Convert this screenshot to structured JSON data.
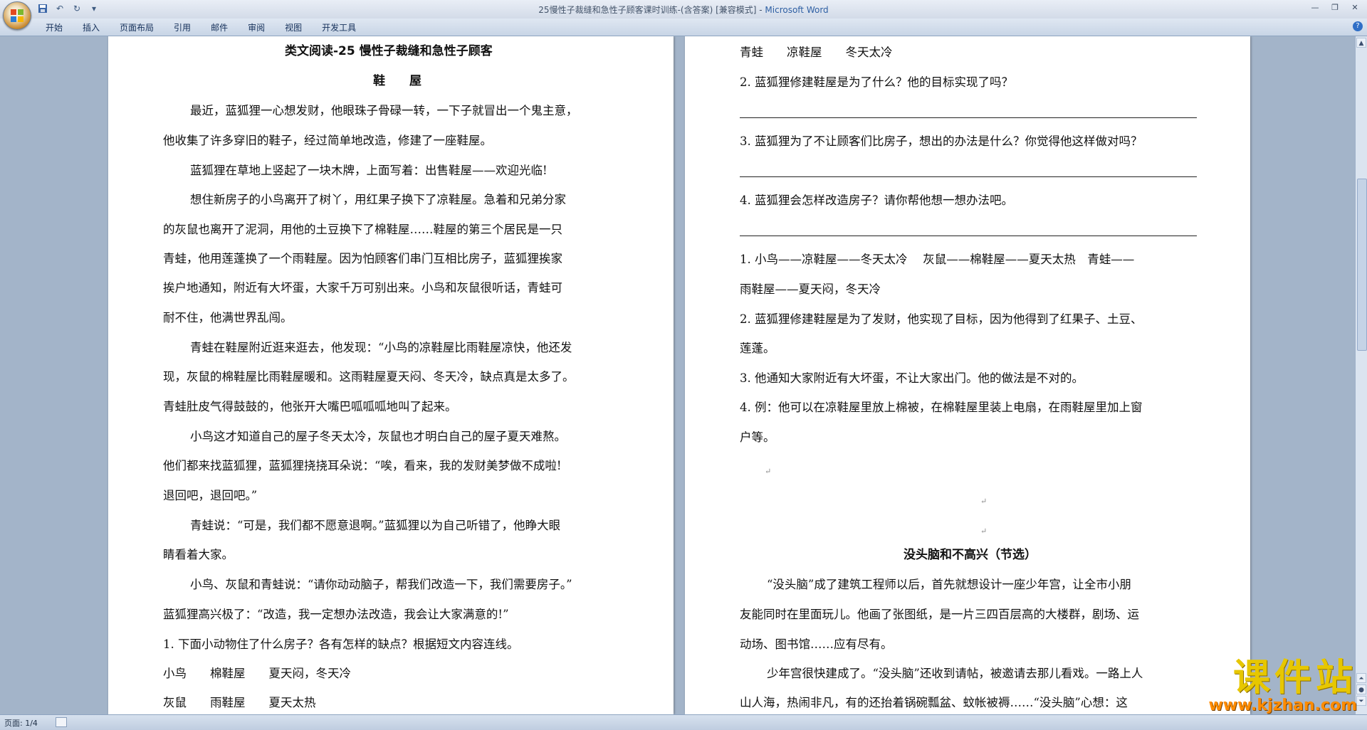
{
  "window": {
    "title_doc": "25慢性子裁缝和急性子顾客课时训练-(含答案) [兼容模式] - ",
    "title_app": "Microsoft Word"
  },
  "ribbon": {
    "tabs": [
      "开始",
      "插入",
      "页面布局",
      "引用",
      "邮件",
      "审阅",
      "视图",
      "开发工具"
    ]
  },
  "page1": {
    "title": "类文阅读-25 慢性子裁缝和急性子顾客",
    "subtitle": "鞋　　屋",
    "lines": [
      "最近，蓝狐狸一心想发财，他眼珠子骨碌一转，一下子就冒出一个鬼主意，",
      "他收集了许多穿旧的鞋子，经过简单地改造，修建了一座鞋屋。",
      "蓝狐狸在草地上竖起了一块木牌，上面写着：出售鞋屋——欢迎光临!",
      "想住新房子的小鸟离开了树丫，用红果子换下了凉鞋屋。急着和兄弟分家",
      "的灰鼠也离开了泥洞，用他的土豆换下了棉鞋屋……鞋屋的第三个居民是一只",
      "青蛙，他用莲蓬换了一个雨鞋屋。因为怕顾客们串门互相比房子，蓝狐狸挨家",
      "挨户地通知，附近有大坏蛋，大家千万可别出来。小鸟和灰鼠很听话，青蛙可",
      "耐不住，他满世界乱闯。",
      "青蛙在鞋屋附近逛来逛去，他发现：“小鸟的凉鞋屋比雨鞋屋凉快，他还发",
      "现，灰鼠的棉鞋屋比雨鞋屋暖和。这雨鞋屋夏天闷、冬天冷，缺点真是太多了。",
      "青蛙肚皮气得鼓鼓的，他张开大嘴巴呱呱呱地叫了起来。",
      "小鸟这才知道自己的屋子冬天太冷，灰鼠也才明白自己的屋子夏天难熬。",
      "他们都来找蓝狐狸，蓝狐狸挠挠耳朵说：“唉，看来，我的发财美梦做不成啦!",
      "退回吧，退回吧。”",
      "青蛙说：“可是，我们都不愿意退啊。”蓝狐狸以为自己听错了，他睁大眼",
      "睛看着大家。",
      "小鸟、灰鼠和青蛙说：“请你动动脑子，帮我们改造一下，我们需要房子。”",
      "蓝狐狸高兴极了：“改造，我一定想办法改造，我会让大家满意的!”",
      "1. 下面小动物住了什么房子？各有怎样的缺点？根据短文内容连线。",
      "小鸟　　棉鞋屋　　夏天闷，冬天冷",
      "灰鼠　　雨鞋屋　　夏天太热"
    ]
  },
  "page2": {
    "lines": [
      "青蛙　　凉鞋屋　　冬天太冷",
      "2. 蓝狐狸修建鞋屋是为了什么？他的目标实现了吗？",
      "3. 蓝狐狸为了不让顾客们比房子，想出的办法是什么？你觉得他这样做对吗？",
      "4. 蓝狐狸会怎样改造房子？请你帮他想一想办法吧。",
      "1. 小鸟——凉鞋屋——冬天太冷　 灰鼠——棉鞋屋——夏天太热　青蛙——",
      "雨鞋屋——夏天闷，冬天冷",
      "2. 蓝狐狸修建鞋屋是为了发财，他实现了目标，因为他得到了红果子、土豆、",
      "莲蓬。",
      "3. 他通知大家附近有大坏蛋，不让大家出门。他的做法是不对的。",
      "4. 例：他可以在凉鞋屋里放上棉被，在棉鞋屋里装上电扇，在雨鞋屋里加上窗",
      "户等。",
      "没头脑和不高兴（节选）",
      "“没头脑”成了建筑工程师以后，首先就想设计一座少年宫，让全市小朋",
      "友能同时在里面玩儿。他画了张图纸，是一片三四百层高的大楼群，剧场、运",
      "动场、图书馆……应有尽有。",
      "少年宫很快建成了。“没头脑”还收到请帖，被邀请去那儿看戏。一路上人",
      "山人海，热闹非凡，有的还抬着锅碗瓢盆、蚊帐被褥……“没头脑”心想：这"
    ]
  },
  "status": {
    "page": "页面: 1/4"
  },
  "watermark": {
    "main": "课件站",
    "sub": "www.kjzhan.com"
  }
}
